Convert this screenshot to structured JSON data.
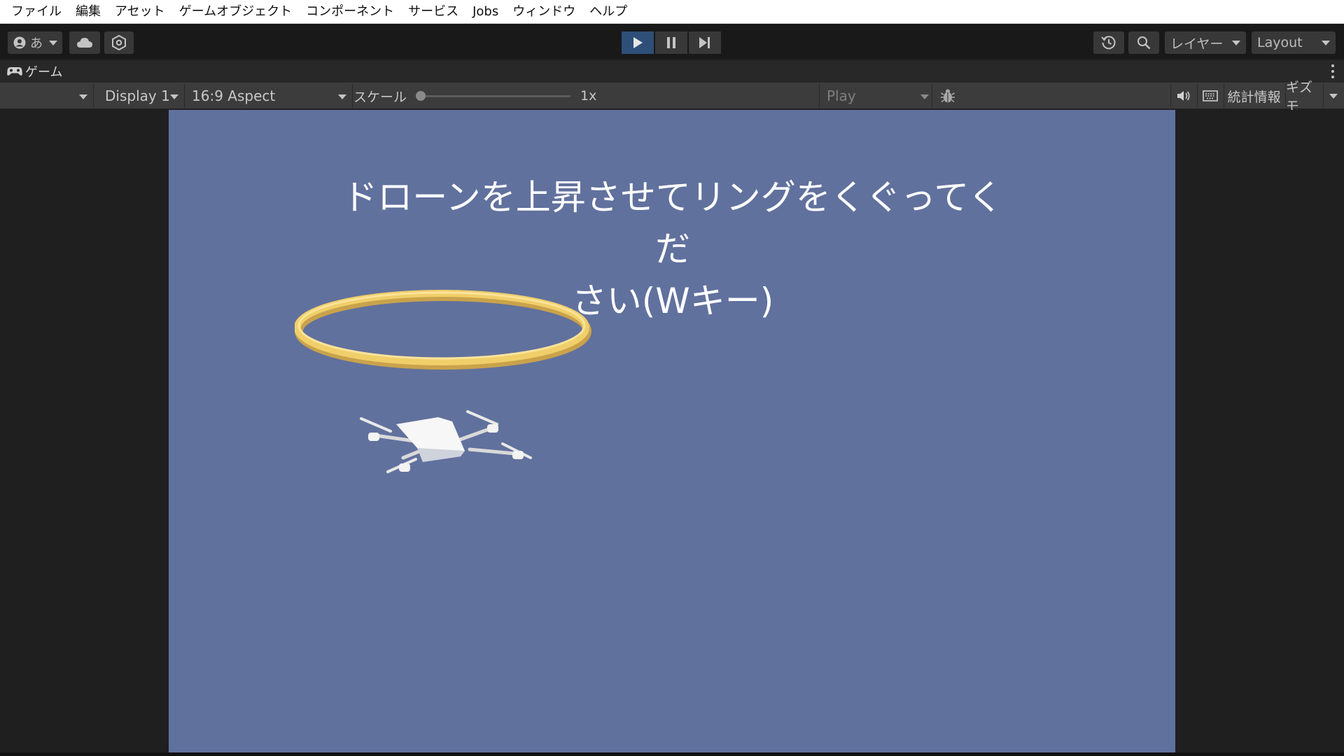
{
  "menu": {
    "items": [
      {
        "label": "ファイル"
      },
      {
        "label": "編集"
      },
      {
        "label": "アセット"
      },
      {
        "label": "ゲームオブジェクト"
      },
      {
        "label": "コンポーネント"
      },
      {
        "label": "サービス"
      },
      {
        "label": "Jobs"
      },
      {
        "label": "ウィンドウ"
      },
      {
        "label": "ヘルプ"
      }
    ]
  },
  "toolbar": {
    "account_label": "あ",
    "layers_label": "レイヤー",
    "layout_label": "Layout",
    "play_state": "playing",
    "colors": {
      "play_active": "#2e4f78"
    }
  },
  "game_tab": {
    "title": "ゲーム"
  },
  "game_controls": {
    "display": "Display 1",
    "aspect": "16:9 Aspect",
    "scale_label": "スケール",
    "scale_value": "1x",
    "scale_fraction": 0.0,
    "play_mode": "Play Maximized",
    "stats_label": "統計情報",
    "gizmos_label": "ギズモ"
  },
  "game_view": {
    "background_color": "#61719d",
    "instruction_line1": "ドローンを上昇させてリングをくぐってくだ",
    "instruction_line2": "さい(Wキー)",
    "ring_color": "#f0cf6a",
    "drone_color": "#ffffff"
  }
}
